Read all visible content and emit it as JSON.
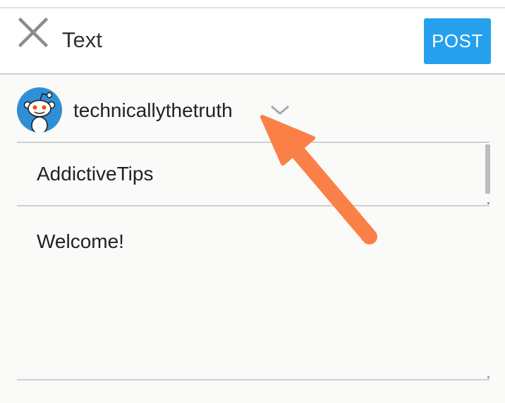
{
  "toolbar": {
    "title": "Text",
    "post_label": "POST",
    "close_icon": "close-icon"
  },
  "account": {
    "username": "technicallythetruth",
    "avatar_icon": "snoo-avatar-icon",
    "dropdown_icon": "chevron-down-icon"
  },
  "post": {
    "title_value": "AddictiveTips",
    "body_value": "Welcome!"
  },
  "colors": {
    "accent": "#24a0ed",
    "avatar_bg": "#2f8fd6",
    "annotation_arrow": "#fb8048"
  }
}
